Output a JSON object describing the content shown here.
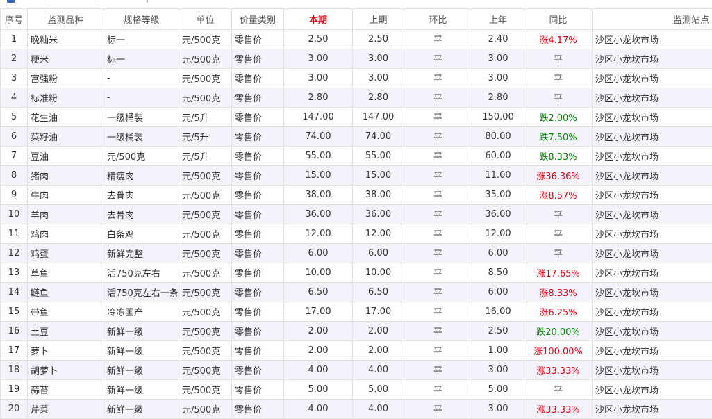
{
  "table": {
    "headers": {
      "index": "序号",
      "item": "监测品种",
      "spec": "规格等级",
      "unit": "单位",
      "price_type": "价量类别",
      "current": "本期",
      "previous": "上期",
      "mom": "环比",
      "last_year": "上年",
      "yoy": "同比",
      "station": "监测站点"
    },
    "rows": [
      {
        "index": "1",
        "item": "晚籼米",
        "spec": "标一",
        "unit": "元/500克",
        "price_type": "零售价",
        "current": "2.50",
        "previous": "2.50",
        "mom": "平",
        "last_year": "2.40",
        "yoy": "涨4.17%",
        "trend": "up",
        "station": "沙区小龙坎市场"
      },
      {
        "index": "2",
        "item": "粳米",
        "spec": "标一",
        "unit": "元/500克",
        "price_type": "零售价",
        "current": "3.00",
        "previous": "3.00",
        "mom": "平",
        "last_year": "3.00",
        "yoy": "平",
        "trend": "flat",
        "station": "沙区小龙坎市场"
      },
      {
        "index": "3",
        "item": "富强粉",
        "spec": "-",
        "unit": "元/500克",
        "price_type": "零售价",
        "current": "3.00",
        "previous": "3.00",
        "mom": "平",
        "last_year": "3.00",
        "yoy": "平",
        "trend": "flat",
        "station": "沙区小龙坎市场"
      },
      {
        "index": "4",
        "item": "标准粉",
        "spec": "-",
        "unit": "元/500克",
        "price_type": "零售价",
        "current": "2.80",
        "previous": "2.80",
        "mom": "平",
        "last_year": "2.80",
        "yoy": "平",
        "trend": "flat",
        "station": "沙区小龙坎市场"
      },
      {
        "index": "5",
        "item": "花生油",
        "spec": "一级桶装",
        "unit": "元/5升",
        "price_type": "零售价",
        "current": "147.00",
        "previous": "147.00",
        "mom": "平",
        "last_year": "150.00",
        "yoy": "跌2.00%",
        "trend": "down",
        "station": "沙区小龙坎市场"
      },
      {
        "index": "6",
        "item": "菜籽油",
        "spec": "一级桶装",
        "unit": "元/5升",
        "price_type": "零售价",
        "current": "74.00",
        "previous": "74.00",
        "mom": "平",
        "last_year": "80.00",
        "yoy": "跌7.50%",
        "trend": "down",
        "station": "沙区小龙坎市场"
      },
      {
        "index": "7",
        "item": "豆油",
        "spec": "元/500克",
        "unit": "元/5升",
        "price_type": "零售价",
        "current": "55.00",
        "previous": "55.00",
        "mom": "平",
        "last_year": "60.00",
        "yoy": "跌8.33%",
        "trend": "down",
        "station": "沙区小龙坎市场"
      },
      {
        "index": "8",
        "item": "猪肉",
        "spec": "精瘦肉",
        "unit": "元/500克",
        "price_type": "零售价",
        "current": "15.00",
        "previous": "15.00",
        "mom": "平",
        "last_year": "11.00",
        "yoy": "涨36.36%",
        "trend": "up",
        "station": "沙区小龙坎市场"
      },
      {
        "index": "9",
        "item": "牛肉",
        "spec": "去骨肉",
        "unit": "元/500克",
        "price_type": "零售价",
        "current": "38.00",
        "previous": "38.00",
        "mom": "平",
        "last_year": "35.00",
        "yoy": "涨8.57%",
        "trend": "up",
        "station": "沙区小龙坎市场"
      },
      {
        "index": "10",
        "item": "羊肉",
        "spec": "去骨肉",
        "unit": "元/500克",
        "price_type": "零售价",
        "current": "36.00",
        "previous": "36.00",
        "mom": "平",
        "last_year": "36.00",
        "yoy": "平",
        "trend": "flat",
        "station": "沙区小龙坎市场"
      },
      {
        "index": "11",
        "item": "鸡肉",
        "spec": "白条鸡",
        "unit": "元/500克",
        "price_type": "零售价",
        "current": "12.00",
        "previous": "12.00",
        "mom": "平",
        "last_year": "12.00",
        "yoy": "平",
        "trend": "flat",
        "station": "沙区小龙坎市场"
      },
      {
        "index": "12",
        "item": "鸡蛋",
        "spec": "新鲜完整",
        "unit": "元/500克",
        "price_type": "零售价",
        "current": "6.00",
        "previous": "6.00",
        "mom": "平",
        "last_year": "6.00",
        "yoy": "平",
        "trend": "flat",
        "station": "沙区小龙坎市场"
      },
      {
        "index": "13",
        "item": "草鱼",
        "spec": "活750克左右",
        "unit": "元/500克",
        "price_type": "零售价",
        "current": "10.00",
        "previous": "10.00",
        "mom": "平",
        "last_year": "8.50",
        "yoy": "涨17.65%",
        "trend": "up",
        "station": "沙区小龙坎市场"
      },
      {
        "index": "14",
        "item": "鲢鱼",
        "spec": "活750克左右一条",
        "unit": "元/500克",
        "price_type": "零售价",
        "current": "6.50",
        "previous": "6.50",
        "mom": "平",
        "last_year": "6.00",
        "yoy": "涨8.33%",
        "trend": "up",
        "station": "沙区小龙坎市场"
      },
      {
        "index": "15",
        "item": "带鱼",
        "spec": "冷冻国产",
        "unit": "元/500克",
        "price_type": "零售价",
        "current": "17.00",
        "previous": "17.00",
        "mom": "平",
        "last_year": "16.00",
        "yoy": "涨6.25%",
        "trend": "up",
        "station": "沙区小龙坎市场"
      },
      {
        "index": "16",
        "item": "土豆",
        "spec": "新鲜一级",
        "unit": "元/500克",
        "price_type": "零售价",
        "current": "2.00",
        "previous": "2.00",
        "mom": "平",
        "last_year": "2.50",
        "yoy": "跌20.00%",
        "trend": "down",
        "station": "沙区小龙坎市场"
      },
      {
        "index": "17",
        "item": "萝卜",
        "spec": "新鲜一级",
        "unit": "元/500克",
        "price_type": "零售价",
        "current": "2.00",
        "previous": "2.00",
        "mom": "平",
        "last_year": "1.00",
        "yoy": "涨100.00%",
        "trend": "up",
        "station": "沙区小龙坎市场"
      },
      {
        "index": "18",
        "item": "胡萝卜",
        "spec": "新鲜一级",
        "unit": "元/500克",
        "price_type": "零售价",
        "current": "4.00",
        "previous": "4.00",
        "mom": "平",
        "last_year": "3.00",
        "yoy": "涨33.33%",
        "trend": "up",
        "station": "沙区小龙坎市场"
      },
      {
        "index": "19",
        "item": "蒜苔",
        "spec": "新鲜一级",
        "unit": "元/500克",
        "price_type": "零售价",
        "current": "5.00",
        "previous": "5.00",
        "mom": "平",
        "last_year": "5.00",
        "yoy": "平",
        "trend": "flat",
        "station": "沙区小龙坎市场"
      },
      {
        "index": "20",
        "item": "芹菜",
        "spec": "新鲜一级",
        "unit": "元/500克",
        "price_type": "零售价",
        "current": "4.00",
        "previous": "4.00",
        "mom": "平",
        "last_year": "3.00",
        "yoy": "涨33.33%",
        "trend": "up",
        "station": "沙区小龙坎市场"
      }
    ]
  },
  "colors": {
    "up": "#e60012",
    "down": "#008a00",
    "current_header": "#e60012",
    "stripe": "#f4f3fb",
    "border": "#e1e1e1"
  }
}
